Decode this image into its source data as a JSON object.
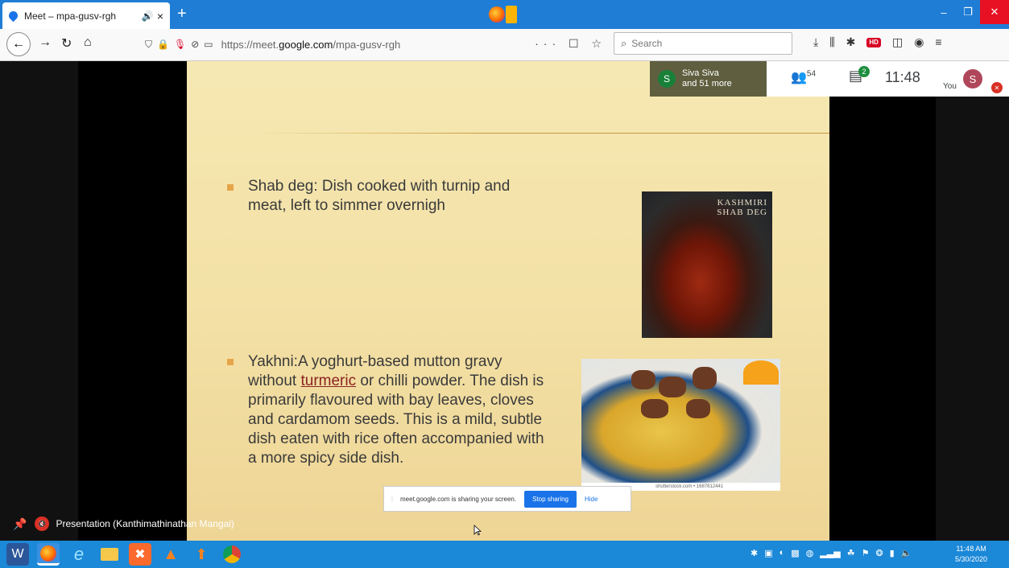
{
  "browser": {
    "tab_title": "Meet – mpa-gusv-rgh",
    "tab_audio_icon": "speaker-icon",
    "tab_close": "×",
    "new_tab": "+",
    "url_prefix": "https://meet.",
    "url_domain": "google.com",
    "url_path": "/mpa-gusv-rgh",
    "page_actions": "··· ☐ ☆",
    "search_placeholder": "Search",
    "hd_badge": "HD"
  },
  "meet": {
    "presenter_initial": "S",
    "presenter_name": "Siva Siva",
    "presenter_more": "and 51 more",
    "people_count": "54",
    "chat_badge": "2",
    "time": "11:48",
    "you_label": "You",
    "you_initial": "S",
    "share_banner_text": "meet.google.com is sharing your screen.",
    "stop_sharing_label": "Stop sharing",
    "hide_label": "Hide",
    "presentation_label": "Presentation (Kanthimathinathan Mangai)"
  },
  "slide": {
    "bullet1_line1": "Shab deg: Dish cooked with turnip and",
    "bullet1_line2": "meat, left to simmer overnigh",
    "image1_caption_line1": "KASHMIRI",
    "image1_caption_line2": "SHAB DEG",
    "bullet2_line1": "Yakhni:A yoghurt-based mutton gravy",
    "bullet2_line2_pre": "without ",
    "bullet2_link": "turmeric",
    "bullet2_line2_post": " or chilli powder. The dish is",
    "bullet2_line3": "primarily flavoured with bay leaves, cloves",
    "bullet2_line4": "and cardamom seeds. This is a mild, subtle",
    "bullet2_line5": "dish eaten with rice often accompanied with",
    "bullet2_line6": "a more spicy side dish.",
    "image2_watermark": "shutterstock.com • 1687812441"
  },
  "taskbar": {
    "clock_time": "11:48 AM",
    "clock_date": "5/30/2020"
  },
  "colors": {
    "firefox_tabstrip": "#1f7dd6",
    "meet_green": "#1e8e3e",
    "meet_red": "#d93025",
    "meet_blue": "#1a73e8",
    "taskbar": "#1b88d8"
  }
}
